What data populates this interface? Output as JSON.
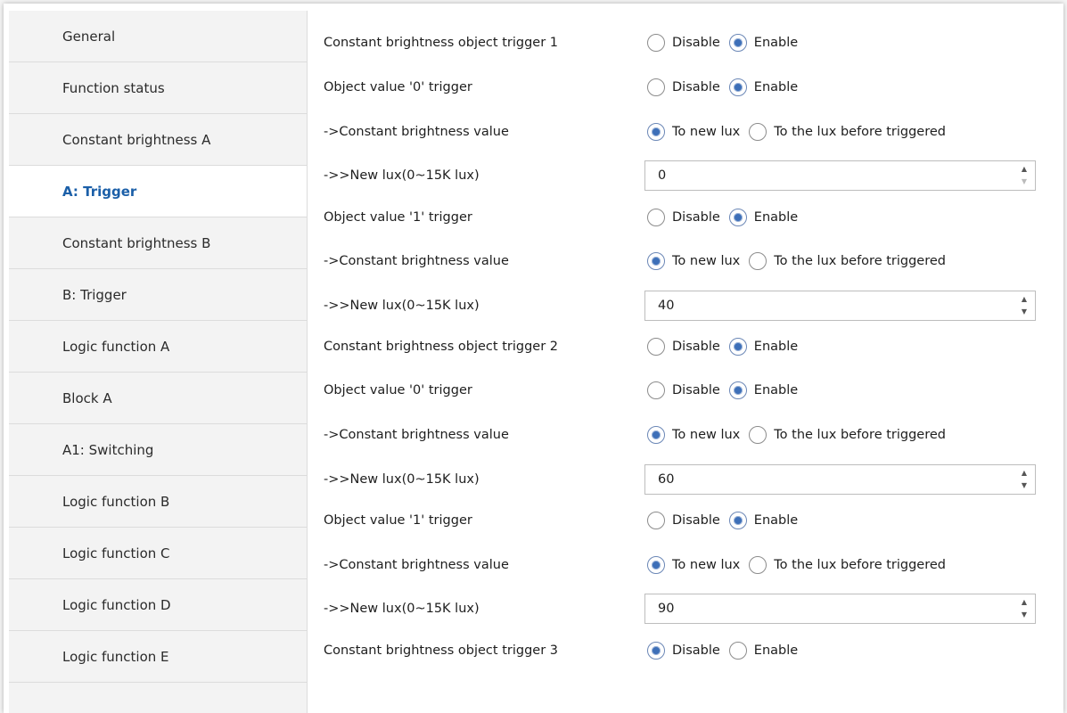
{
  "sidebar": {
    "items": [
      {
        "label": "General"
      },
      {
        "label": "Function status"
      },
      {
        "label": "Constant brightness A"
      },
      {
        "label": "A: Trigger",
        "active": true
      },
      {
        "label": "Constant brightness B"
      },
      {
        "label": "B: Trigger"
      },
      {
        "label": "Logic function A"
      },
      {
        "label": "Block A"
      },
      {
        "label": "A1: Switching"
      },
      {
        "label": "Logic function B"
      },
      {
        "label": "Logic function C"
      },
      {
        "label": "Logic function D"
      },
      {
        "label": "Logic function E"
      }
    ]
  },
  "params": {
    "trigger1": {
      "label": "Constant brightness object trigger  1",
      "opt_a": "Disable",
      "opt_b": "Enable",
      "selected": "Enable"
    },
    "t1_obj0": {
      "label": "Object value '0' trigger",
      "opt_a": "Disable",
      "opt_b": "Enable",
      "selected": "Enable"
    },
    "t1_obj0_cbv": {
      "label": "->Constant brightness value",
      "opt_a": "To new lux",
      "opt_b": "To the lux before triggered",
      "selected": "To new lux"
    },
    "t1_obj0_lux": {
      "label": "->>New lux(0~15K lux)",
      "value": "0"
    },
    "t1_obj1": {
      "label": "Object value '1' trigger",
      "opt_a": "Disable",
      "opt_b": "Enable",
      "selected": "Enable"
    },
    "t1_obj1_cbv": {
      "label": "->Constant brightness value",
      "opt_a": "To new lux",
      "opt_b": "To the lux before triggered",
      "selected": "To new lux"
    },
    "t1_obj1_lux": {
      "label": "->>New lux(0~15K lux)",
      "value": "40"
    },
    "trigger2": {
      "label": "Constant brightness object trigger  2",
      "opt_a": "Disable",
      "opt_b": "Enable",
      "selected": "Enable"
    },
    "t2_obj0": {
      "label": "Object value '0' trigger",
      "opt_a": "Disable",
      "opt_b": "Enable",
      "selected": "Enable"
    },
    "t2_obj0_cbv": {
      "label": "->Constant brightness value",
      "opt_a": "To new lux",
      "opt_b": "To the lux before triggered",
      "selected": "To new lux"
    },
    "t2_obj0_lux": {
      "label": "->>New lux(0~15K lux)",
      "value": "60"
    },
    "t2_obj1": {
      "label": "Object value '1' trigger",
      "opt_a": "Disable",
      "opt_b": "Enable",
      "selected": "Enable"
    },
    "t2_obj1_cbv": {
      "label": "->Constant brightness value",
      "opt_a": "To new lux",
      "opt_b": "To the lux before triggered",
      "selected": "To new lux"
    },
    "t2_obj1_lux": {
      "label": "->>New lux(0~15K lux)",
      "value": "90"
    },
    "trigger3": {
      "label": "Constant brightness object trigger  3",
      "opt_a": "Disable",
      "opt_b": "Enable",
      "selected": "Disable"
    }
  },
  "colors": {
    "active_text": "#1b5fa8",
    "radio_dot": "#3d6fb8",
    "sidebar_bg": "#f3f3f3"
  }
}
